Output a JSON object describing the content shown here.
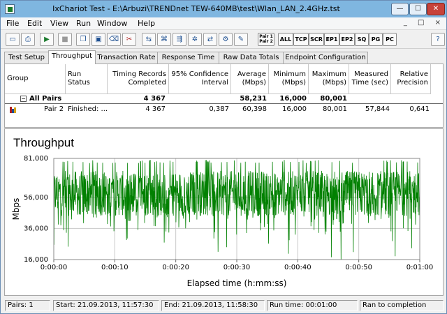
{
  "window": {
    "title": "IxChariot Test - E:\\Arbuzi\\TRENDnet TEW-640MB\\test\\Wlan_LAN_2.4GHz.tst",
    "minimize_glyph": "—",
    "maximize_glyph": "☐",
    "close_glyph": "✕"
  },
  "menu": [
    "File",
    "Edit",
    "View",
    "Run",
    "Window",
    "Help"
  ],
  "mdi_controls": "_ □ ×",
  "toolbar": {
    "icons": [
      "new-icon",
      "print-icon",
      "run-icon",
      "stop-icon",
      "copy-icon",
      "paste-icon",
      "delete-icon",
      "scissors-icon",
      "pair-icon",
      "network-icon",
      "network-alt-icon",
      "multicast-icon",
      "endpoint-icon",
      "options-icon",
      "edit-icon"
    ],
    "pair_label": "Pair 1\nPair 2",
    "filters": [
      "ALL",
      "TCP",
      "SCR",
      "EP1",
      "EP2",
      "SQ",
      "PG",
      "PC"
    ]
  },
  "tabs": [
    "Test Setup",
    "Throughput",
    "Transaction Rate",
    "Response Time",
    "Raw Data Totals",
    "Endpoint Configuration"
  ],
  "active_tab": "Throughput",
  "table": {
    "headers": [
      "Group",
      "Run Status",
      "Timing Records\nCompleted",
      "95% Confidence\nInterval",
      "Average\n(Mbps)",
      "Minimum\n(Mbps)",
      "Maximum\n(Mbps)",
      "Measured\nTime (sec)",
      "Relative\nPrecision"
    ],
    "all_pairs": {
      "expand_glyph": "−",
      "group": "All Pairs",
      "records": "4 367",
      "average": "58,231",
      "minimum": "16,000",
      "maximum": "80,001"
    },
    "pair2": {
      "group": "Pair 2",
      "status": "Finished: ...",
      "records": "4 367",
      "confidence": "0,387",
      "average": "60,398",
      "minimum": "16,000",
      "maximum": "80,001",
      "measured": "57,844",
      "precision": "0,641"
    }
  },
  "chart_title": "Throughput",
  "chart_data": {
    "type": "line",
    "title": "Throughput",
    "xlabel": "Elapsed time (h:mm:ss)",
    "ylabel": "Mbps",
    "x_ticks": [
      "0:00:00",
      "0:00:10",
      "0:00:20",
      "0:00:30",
      "0:00:40",
      "0:00:50",
      "0:01:00"
    ],
    "xlim_seconds": [
      0,
      60
    ],
    "y_ticks": [
      "16,000",
      "36,000",
      "56,000",
      "81,000"
    ],
    "y_tick_values": [
      16,
      36,
      56,
      81
    ],
    "ylim": [
      16,
      81
    ],
    "grid": true,
    "series": [
      {
        "name": "Pair 2",
        "color": "#008000",
        "samples": 4367,
        "average": 60.398,
        "minimum": 16.0,
        "maximum": 80.001,
        "typical_low": 44.0,
        "typical_high": 73.0
      }
    ]
  },
  "status": {
    "pairs": "Pairs: 1",
    "start": "Start: 21.09.2013, 11:57:30",
    "end": "End: 21.09.2013, 11:58:30",
    "run_time": "Run time: 00:01:00",
    "state": "Ran to completion"
  }
}
